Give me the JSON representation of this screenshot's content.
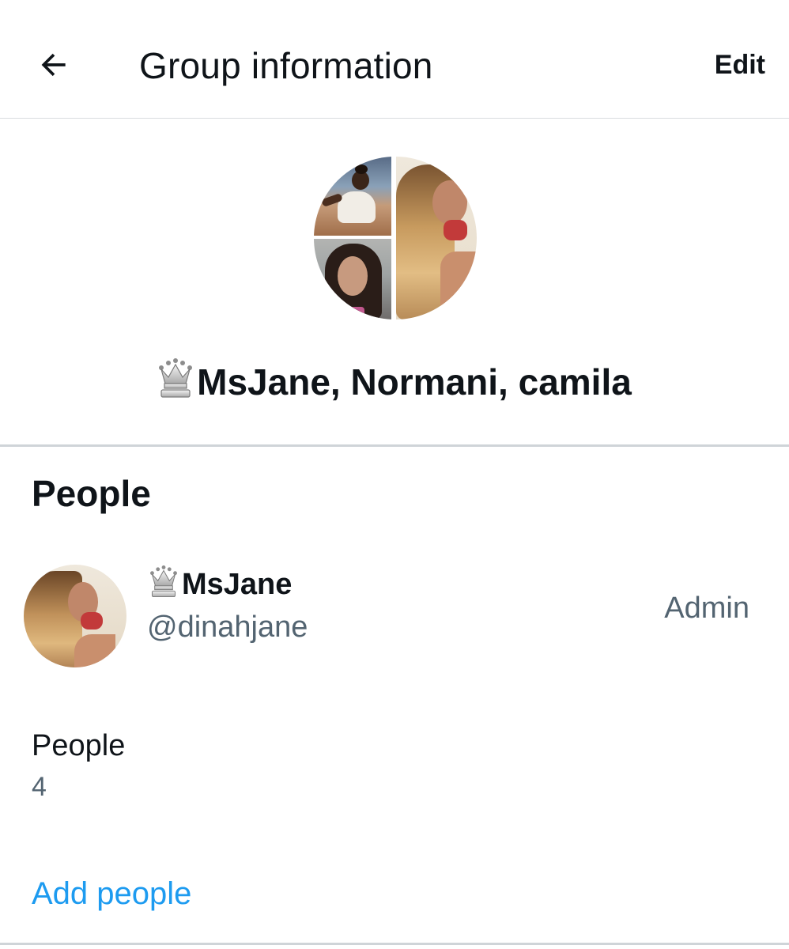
{
  "header": {
    "back_icon": "arrow-left-icon",
    "title": "Group information",
    "edit_label": "Edit"
  },
  "group": {
    "name": "MsJane, Normani, camila",
    "name_prefix_icon": "chess-queen-icon"
  },
  "people_section": {
    "heading": "People",
    "members": [
      {
        "display_name": "MsJane",
        "name_prefix_icon": "chess-queen-icon",
        "handle": "@dinahjane",
        "role": "Admin"
      }
    ],
    "count_label": "People",
    "count_value": "4",
    "add_label": "Add people"
  },
  "colors": {
    "text_primary": "#0f1419",
    "text_secondary": "#536471",
    "accent": "#1d9bf0",
    "divider": "#cfd4d8"
  }
}
